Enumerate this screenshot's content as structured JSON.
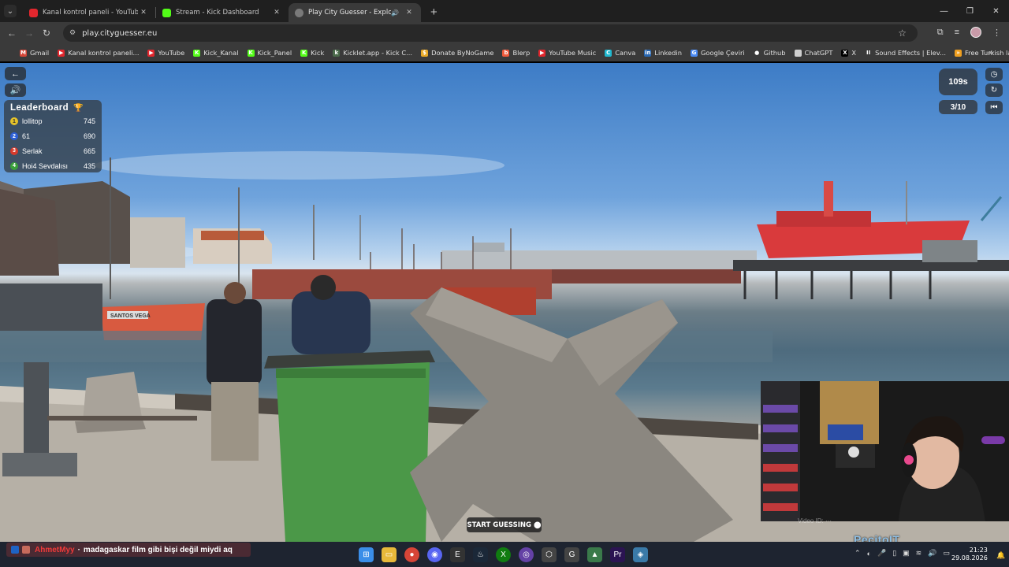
{
  "browser": {
    "tabs": [
      {
        "title": "Kanal kontrol paneli - YouTube",
        "color": "#e2272e",
        "active": false
      },
      {
        "title": "Stream - Kick Dashboard",
        "color": "#53fc18",
        "active": false
      },
      {
        "title": "Play City Guesser - Explore",
        "color": "#7a7a7a",
        "active": true,
        "audio": "🔊"
      }
    ],
    "url": "play.cityguesser.eu",
    "bookmarks": [
      {
        "label": "Gmail",
        "icon": "gmail-icon",
        "color": "#d44638",
        "glyph": "M"
      },
      {
        "label": "Kanal kontrol paneli...",
        "icon": "youtube-icon",
        "color": "#e2272e",
        "glyph": "▶"
      },
      {
        "label": "YouTube",
        "icon": "youtube-icon",
        "color": "#e2272e",
        "glyph": "▶"
      },
      {
        "label": "Kick_Kanal",
        "icon": "kick-icon",
        "color": "#53fc18",
        "glyph": "K"
      },
      {
        "label": "Kick_Panel",
        "icon": "kick-icon",
        "color": "#53fc18",
        "glyph": "K"
      },
      {
        "label": "Kick",
        "icon": "kick-icon",
        "color": "#53fc18",
        "glyph": "K"
      },
      {
        "label": "Kicklet.app - Kick C...",
        "icon": "kicklet-icon",
        "color": "#4a6a4a",
        "glyph": "k"
      },
      {
        "label": "Donate ByNoGame",
        "icon": "donate-icon",
        "color": "#e8a825",
        "glyph": "$"
      },
      {
        "label": "Blerp",
        "icon": "blerp-icon",
        "color": "#ef5a3c",
        "glyph": "b"
      },
      {
        "label": "YouTube Music",
        "icon": "youtube-music-icon",
        "color": "#e2272e",
        "glyph": "▶"
      },
      {
        "label": "Canva",
        "icon": "canva-icon",
        "color": "#20b8cf",
        "glyph": "C"
      },
      {
        "label": "Linkedin",
        "icon": "linkedin-icon",
        "color": "#2867b2",
        "glyph": "in"
      },
      {
        "label": "Google Çeviri",
        "icon": "translate-icon",
        "color": "#4a8af4",
        "glyph": "G"
      },
      {
        "label": "Github",
        "icon": "github-icon",
        "color": "#ffffff",
        "glyph": "●"
      },
      {
        "label": "ChatGPT",
        "icon": "chatgpt-icon",
        "color": "#cfcfcf",
        "glyph": "✱"
      },
      {
        "label": "X",
        "icon": "x-icon",
        "color": "#000000",
        "glyph": "X"
      },
      {
        "label": "Sound Effects | Elev...",
        "icon": "elevenlabs-icon",
        "color": "#ffffff",
        "glyph": "II"
      },
      {
        "label": "Free Turkish langua...",
        "icon": "language-icon",
        "color": "#f0a020",
        "glyph": "»"
      }
    ]
  },
  "game": {
    "leaderboard_title": "Leaderboard",
    "leaderboard": [
      {
        "rank": "1",
        "name": "lollitop",
        "score": "745",
        "color": "#e6c329"
      },
      {
        "rank": "2",
        "name": "61",
        "score": "690",
        "color": "#2c5fd6"
      },
      {
        "rank": "3",
        "name": "Serlak",
        "score": "665",
        "color": "#d63a2c"
      },
      {
        "rank": "4",
        "name": "Hoi4 Sevdalısı",
        "score": "435",
        "color": "#3aa03a"
      }
    ],
    "timer": "109s",
    "round": "3/10",
    "start_button": "START GUESSING",
    "boat_name": "SANTOS VEGA"
  },
  "stream": {
    "chat_user": "AhmetMyy",
    "chat_message": "madagaskar film gibi bişi değil miydi aq",
    "brand": "PecitoIT"
  },
  "system": {
    "time": "21:23",
    "date": "29.08.2026"
  }
}
